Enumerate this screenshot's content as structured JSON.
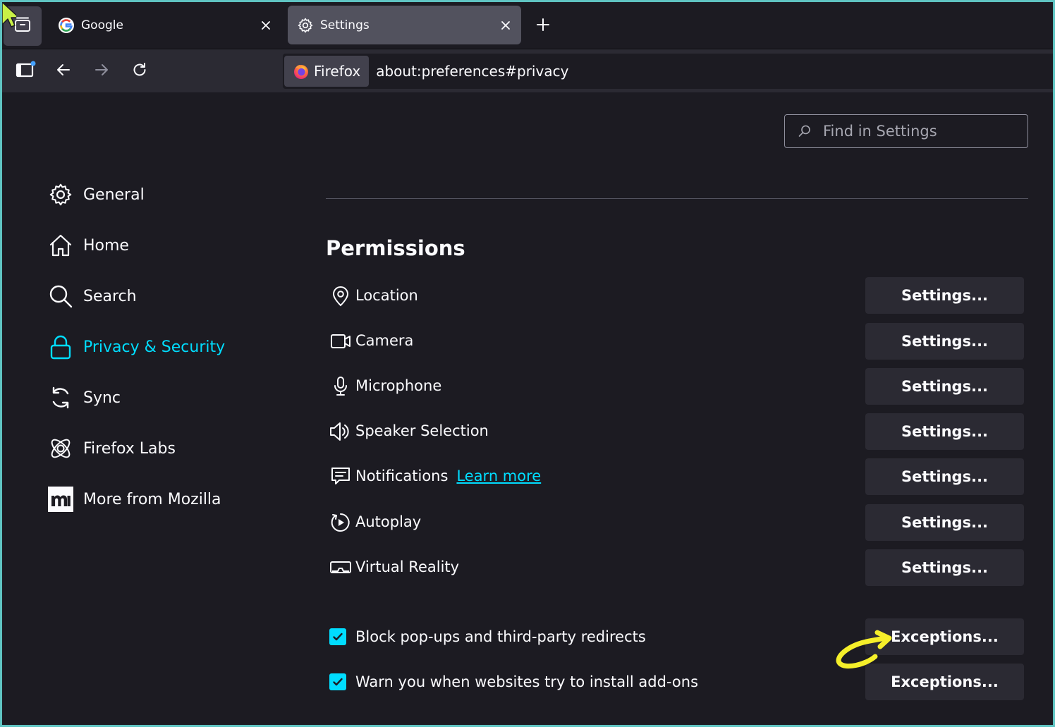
{
  "tabs": [
    {
      "label": "Google",
      "icon": "google-g-icon"
    },
    {
      "label": "Settings",
      "icon": "gear-icon",
      "active": true
    }
  ],
  "nav": {
    "identity_label": "Firefox",
    "url": "about:preferences#privacy"
  },
  "search": {
    "placeholder": "Find in Settings"
  },
  "sidebar": {
    "items": [
      {
        "label": "General",
        "icon": "gear-icon"
      },
      {
        "label": "Home",
        "icon": "home-icon"
      },
      {
        "label": "Search",
        "icon": "search-icon"
      },
      {
        "label": "Privacy & Security",
        "icon": "lock-icon",
        "selected": true
      },
      {
        "label": "Sync",
        "icon": "sync-icon"
      },
      {
        "label": "Firefox Labs",
        "icon": "atom-icon"
      },
      {
        "label": "More from Mozilla",
        "icon": "mozilla-m-icon"
      }
    ]
  },
  "permissions": {
    "heading": "Permissions",
    "rows": [
      {
        "label": "Location",
        "icon": "location-pin-icon",
        "button": "Settings..."
      },
      {
        "label": "Camera",
        "icon": "camera-icon",
        "button": "Settings..."
      },
      {
        "label": "Microphone",
        "icon": "microphone-icon",
        "button": "Settings..."
      },
      {
        "label": "Speaker Selection",
        "icon": "speaker-icon",
        "button": "Settings..."
      },
      {
        "label": "Notifications",
        "icon": "notification-icon",
        "link": "Learn more",
        "button": "Settings..."
      },
      {
        "label": "Autoplay",
        "icon": "autoplay-icon",
        "button": "Settings..."
      },
      {
        "label": "Virtual Reality",
        "icon": "vr-headset-icon",
        "button": "Settings..."
      }
    ],
    "checks": [
      {
        "label": "Block pop-ups and third-party redirects",
        "checked": true,
        "button": "Exceptions..."
      },
      {
        "label": "Warn you when websites try to install add-ons",
        "checked": true,
        "button": "Exceptions..."
      }
    ]
  },
  "colors": {
    "accent": "#00ddff",
    "background": "#1c1b22",
    "button": "#2b2a33",
    "annotation_arrow": "#f5ef2a"
  }
}
